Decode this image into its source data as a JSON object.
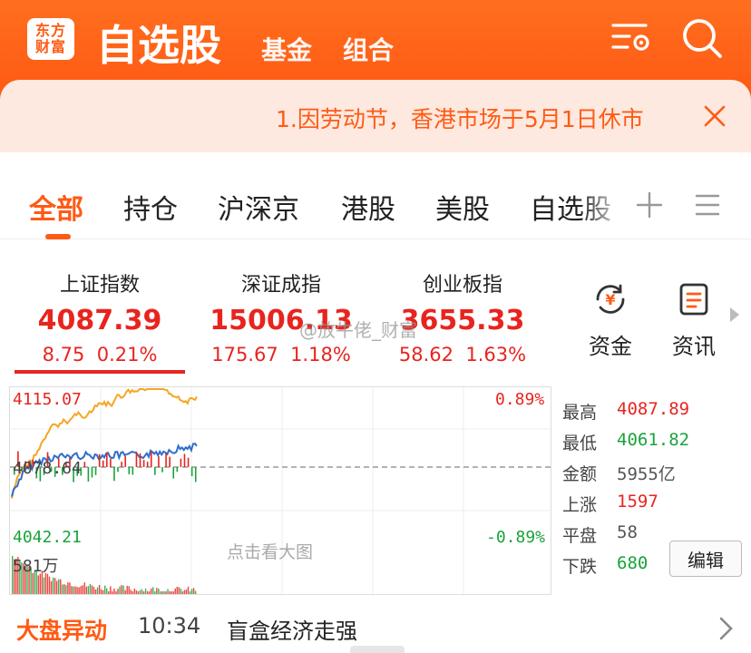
{
  "header": {
    "logo_line1": "东方",
    "logo_line2": "财富",
    "title": "自选股",
    "nav": [
      "基金",
      "组合"
    ],
    "icons": [
      "settings-list-icon",
      "search-icon"
    ]
  },
  "notice": {
    "text": "1.因劳动节，香港市场于5月1日休市"
  },
  "tabs": [
    "全部",
    "持仓",
    "沪深京",
    "港股",
    "美股",
    "自选股"
  ],
  "indices": [
    {
      "name": "上证指数",
      "value": "4087.39",
      "change": "8.75",
      "pct": "0.21%"
    },
    {
      "name": "深证成指",
      "value": "15006.13",
      "change": "175.67",
      "pct": "1.18%"
    },
    {
      "name": "创业板指",
      "value": "3655.33",
      "change": "58.62",
      "pct": "1.63%"
    }
  ],
  "quick": [
    {
      "label": "资金",
      "icon": "yen-refresh-icon"
    },
    {
      "label": "资讯",
      "icon": "news-icon"
    }
  ],
  "watermark": "@放牛佬_财富",
  "chart": {
    "high_label": "4115.07",
    "mid_label": "4078.64",
    "low_label": "4042.21",
    "high_pct": "0.89%",
    "low_pct": "-0.89%",
    "volume_label": "581万",
    "hint": "点击看大图",
    "colors": {
      "price": "#f5a623",
      "avg": "#2f6ecb",
      "up": "#e8241f",
      "down": "#1aa33a"
    }
  },
  "stats": [
    {
      "label": "最高",
      "value": "4087.89",
      "color": "red"
    },
    {
      "label": "最低",
      "value": "4061.82",
      "color": "green"
    },
    {
      "label": "金额",
      "value": "5955亿",
      "color": "gray"
    },
    {
      "label": "上涨",
      "value": "1597",
      "color": "red"
    },
    {
      "label": "平盘",
      "value": "58",
      "color": "gray"
    },
    {
      "label": "下跌",
      "value": "680",
      "color": "green"
    }
  ],
  "edit_label": "编辑",
  "bottom": {
    "tag": "大盘异动",
    "time": "10:34",
    "text": "盲盒经济走强"
  }
}
